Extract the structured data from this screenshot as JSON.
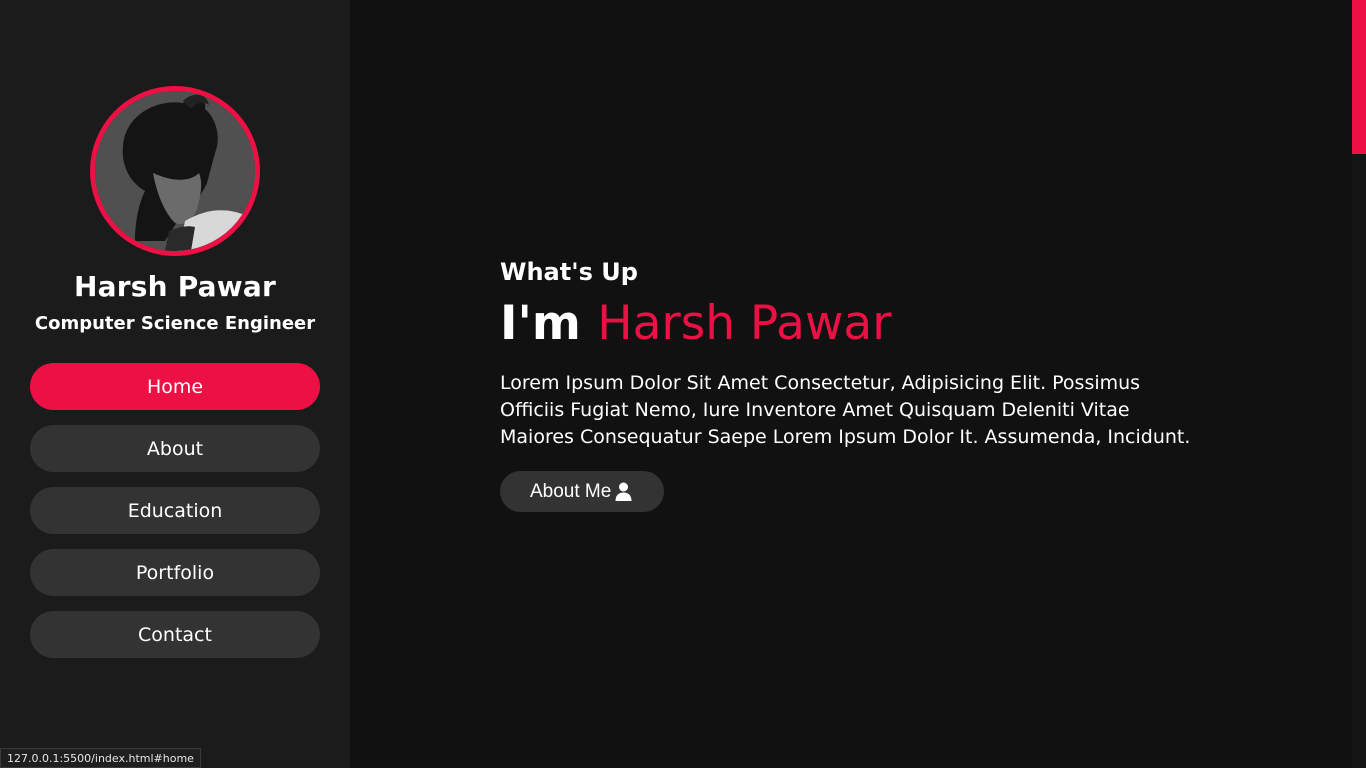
{
  "colors": {
    "accent": "#ec1045",
    "sidebar_bg": "#1b1b1b",
    "main_bg": "#111111",
    "button_bg": "#333333",
    "text": "#ffffff"
  },
  "profile": {
    "name": "Harsh Pawar",
    "role": "Computer Science Engineer",
    "avatar_icon": "profile-photo"
  },
  "nav": {
    "items": [
      {
        "label": "Home",
        "active": true
      },
      {
        "label": "About",
        "active": false
      },
      {
        "label": "Education",
        "active": false
      },
      {
        "label": "Portfolio",
        "active": false
      },
      {
        "label": "Contact",
        "active": false
      }
    ]
  },
  "hero": {
    "eyebrow": "What's Up",
    "headline_prefix": "I'm",
    "headline_name": "Harsh Pawar",
    "lead": "Lorem Ipsum Dolor Sit Amet Consectetur, Adipisicing Elit. Possimus Officiis Fugiat Nemo, Iure Inventore Amet Quisquam Deleniti Vitae Maiores Consequatur Saepe Lorem Ipsum Dolor It. Assumenda, Incidunt.",
    "about_button": "About Me",
    "about_button_icon": "user-icon"
  },
  "status_bar": {
    "url": "127.0.0.1:5500/index.html#home"
  }
}
